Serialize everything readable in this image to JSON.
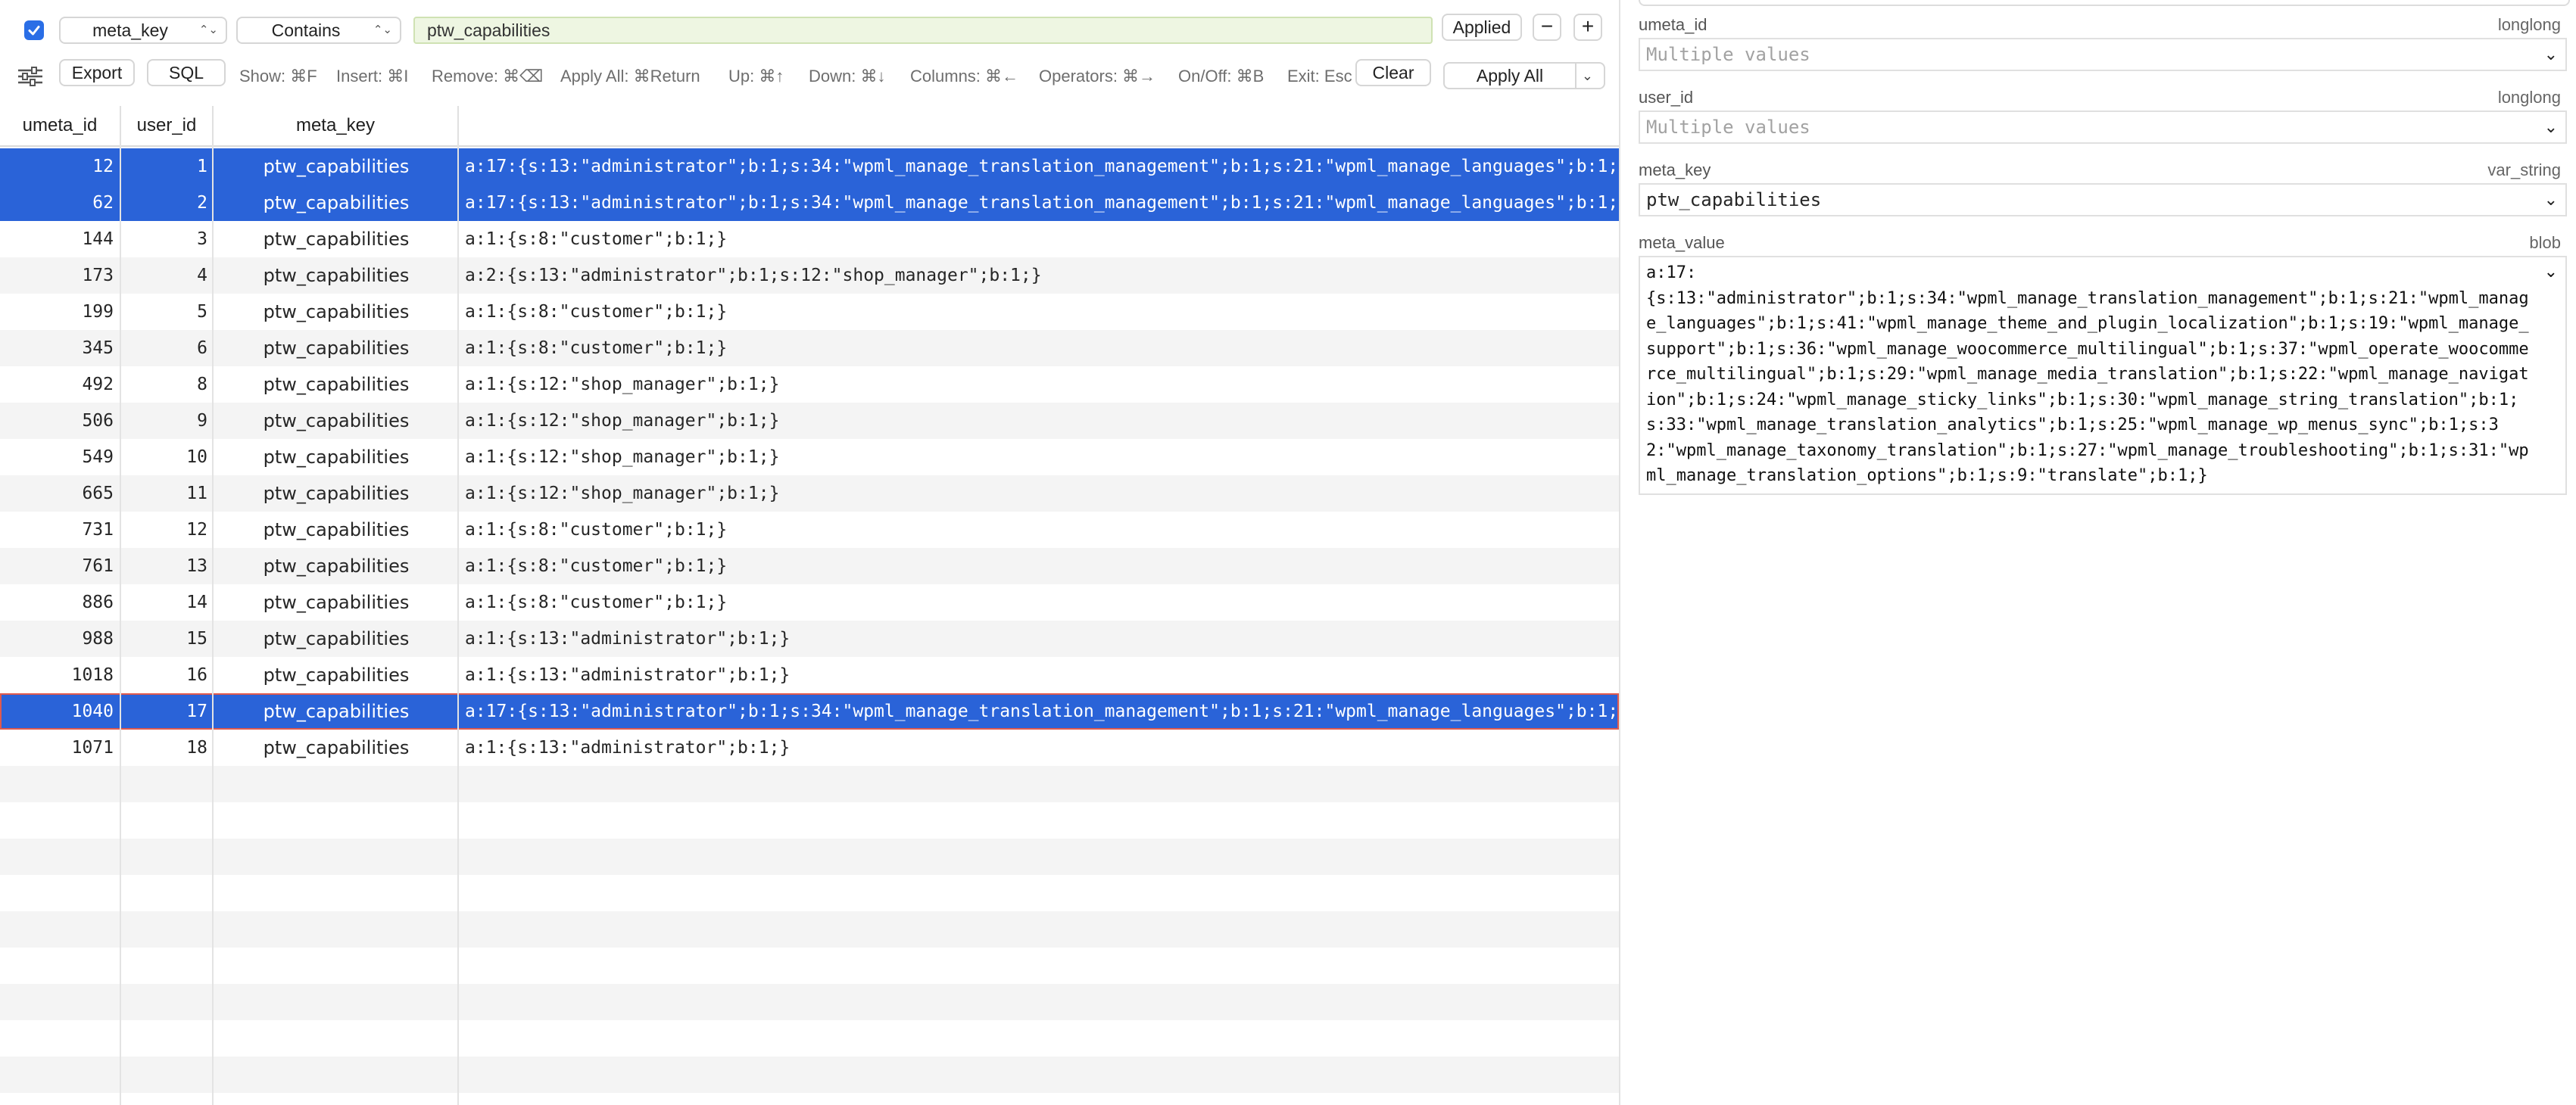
{
  "filter": {
    "column": "meta_key",
    "operator": "Contains",
    "value": "ptw_capabilities",
    "applied_label": "Applied",
    "minus_label": "−",
    "plus_label": "+"
  },
  "toolbar": {
    "export_label": "Export",
    "sql_label": "SQL",
    "hints": {
      "show": "Show: ⌘F",
      "insert": "Insert: ⌘I",
      "remove": "Remove: ⌘⌫",
      "apply_all": "Apply All: ⌘Return",
      "up": "Up: ⌘↑",
      "down": "Down: ⌘↓",
      "columns": "Columns: ⌘←",
      "operators": "Operators: ⌘→",
      "onoff": "On/Off: ⌘B",
      "exit": "Exit: Esc"
    },
    "clear_label": "Clear",
    "apply_all_label": "Apply All"
  },
  "table": {
    "columns": [
      "umeta_id",
      "user_id",
      "meta_key",
      ""
    ],
    "rows": [
      {
        "umeta_id": "12",
        "user_id": "1",
        "meta_key": "ptw_capabilities",
        "meta_value": "a:17:{s:13:\"administrator\";b:1;s:34:\"wpml_manage_translation_management\";b:1;s:21:\"wpml_manage_languages\";b:1;",
        "selected": true
      },
      {
        "umeta_id": "62",
        "user_id": "2",
        "meta_key": "ptw_capabilities",
        "meta_value": "a:17:{s:13:\"administrator\";b:1;s:34:\"wpml_manage_translation_management\";b:1;s:21:\"wpml_manage_languages\";b:1;",
        "selected": true
      },
      {
        "umeta_id": "144",
        "user_id": "3",
        "meta_key": "ptw_capabilities",
        "meta_value": "a:1:{s:8:\"customer\";b:1;}",
        "selected": false
      },
      {
        "umeta_id": "173",
        "user_id": "4",
        "meta_key": "ptw_capabilities",
        "meta_value": "a:2:{s:13:\"administrator\";b:1;s:12:\"shop_manager\";b:1;}",
        "selected": false
      },
      {
        "umeta_id": "199",
        "user_id": "5",
        "meta_key": "ptw_capabilities",
        "meta_value": "a:1:{s:8:\"customer\";b:1;}",
        "selected": false
      },
      {
        "umeta_id": "345",
        "user_id": "6",
        "meta_key": "ptw_capabilities",
        "meta_value": "a:1:{s:8:\"customer\";b:1;}",
        "selected": false
      },
      {
        "umeta_id": "492",
        "user_id": "8",
        "meta_key": "ptw_capabilities",
        "meta_value": "a:1:{s:12:\"shop_manager\";b:1;}",
        "selected": false
      },
      {
        "umeta_id": "506",
        "user_id": "9",
        "meta_key": "ptw_capabilities",
        "meta_value": "a:1:{s:12:\"shop_manager\";b:1;}",
        "selected": false
      },
      {
        "umeta_id": "549",
        "user_id": "10",
        "meta_key": "ptw_capabilities",
        "meta_value": "a:1:{s:12:\"shop_manager\";b:1;}",
        "selected": false
      },
      {
        "umeta_id": "665",
        "user_id": "11",
        "meta_key": "ptw_capabilities",
        "meta_value": "a:1:{s:12:\"shop_manager\";b:1;}",
        "selected": false
      },
      {
        "umeta_id": "731",
        "user_id": "12",
        "meta_key": "ptw_capabilities",
        "meta_value": "a:1:{s:8:\"customer\";b:1;}",
        "selected": false
      },
      {
        "umeta_id": "761",
        "user_id": "13",
        "meta_key": "ptw_capabilities",
        "meta_value": "a:1:{s:8:\"customer\";b:1;}",
        "selected": false
      },
      {
        "umeta_id": "886",
        "user_id": "14",
        "meta_key": "ptw_capabilities",
        "meta_value": "a:1:{s:8:\"customer\";b:1;}",
        "selected": false
      },
      {
        "umeta_id": "988",
        "user_id": "15",
        "meta_key": "ptw_capabilities",
        "meta_value": "a:1:{s:13:\"administrator\";b:1;}",
        "selected": false
      },
      {
        "umeta_id": "1018",
        "user_id": "16",
        "meta_key": "ptw_capabilities",
        "meta_value": "a:1:{s:13:\"administrator\";b:1;}",
        "selected": false
      },
      {
        "umeta_id": "1040",
        "user_id": "17",
        "meta_key": "ptw_capabilities",
        "meta_value": "a:17:{s:13:\"administrator\";b:1;s:34:\"wpml_manage_translation_management\";b:1;s:21:\"wpml_manage_languages\";b:1;",
        "selected": true,
        "focused": true
      },
      {
        "umeta_id": "1071",
        "user_id": "18",
        "meta_key": "ptw_capabilities",
        "meta_value": "a:1:{s:13:\"administrator\";b:1;}",
        "selected": false
      }
    ]
  },
  "inspector": {
    "fields": [
      {
        "name": "umeta_id",
        "type": "longlong",
        "value": "Multiple values",
        "placeholder": true
      },
      {
        "name": "user_id",
        "type": "longlong",
        "value": "Multiple values",
        "placeholder": true
      },
      {
        "name": "meta_key",
        "type": "var_string",
        "value": "ptw_capabilities",
        "placeholder": false
      }
    ],
    "blob": {
      "name": "meta_value",
      "type": "blob",
      "value": "a:17:\n{s:13:\"administrator\";b:1;s:34:\"wpml_manage_translation_management\";b:1;s:21:\"wpml_manage_languages\";b:1;s:41:\"wpml_manage_theme_and_plugin_localization\";b:1;s:19:\"wpml_manage_support\";b:1;s:36:\"wpml_manage_woocommerce_multilingual\";b:1;s:37:\"wpml_operate_woocommerce_multilingual\";b:1;s:29:\"wpml_manage_media_translation\";b:1;s:22:\"wpml_manage_navigation\";b:1;s:24:\"wpml_manage_sticky_links\";b:1;s:30:\"wpml_manage_string_translation\";b:1;s:33:\"wpml_manage_translation_analytics\";b:1;s:25:\"wpml_manage_wp_menus_sync\";b:1;s:32:\"wpml_manage_taxonomy_translation\";b:1;s:27:\"wpml_manage_troubleshooting\";b:1;s:31:\"wpml_manage_translation_options\";b:1;s:9:\"translate\";b:1;}"
    }
  },
  "colors": {
    "selection": "#2a63d8",
    "checkbox": "#2a6ee6",
    "filter_field_bg": "#eef6e2"
  },
  "icons": {
    "filter_enabled": "checkmark-icon",
    "popup_arrows": "up-down-chevron-icon",
    "adjustments": "sliders-icon",
    "dropdown": "chevron-down-icon"
  }
}
